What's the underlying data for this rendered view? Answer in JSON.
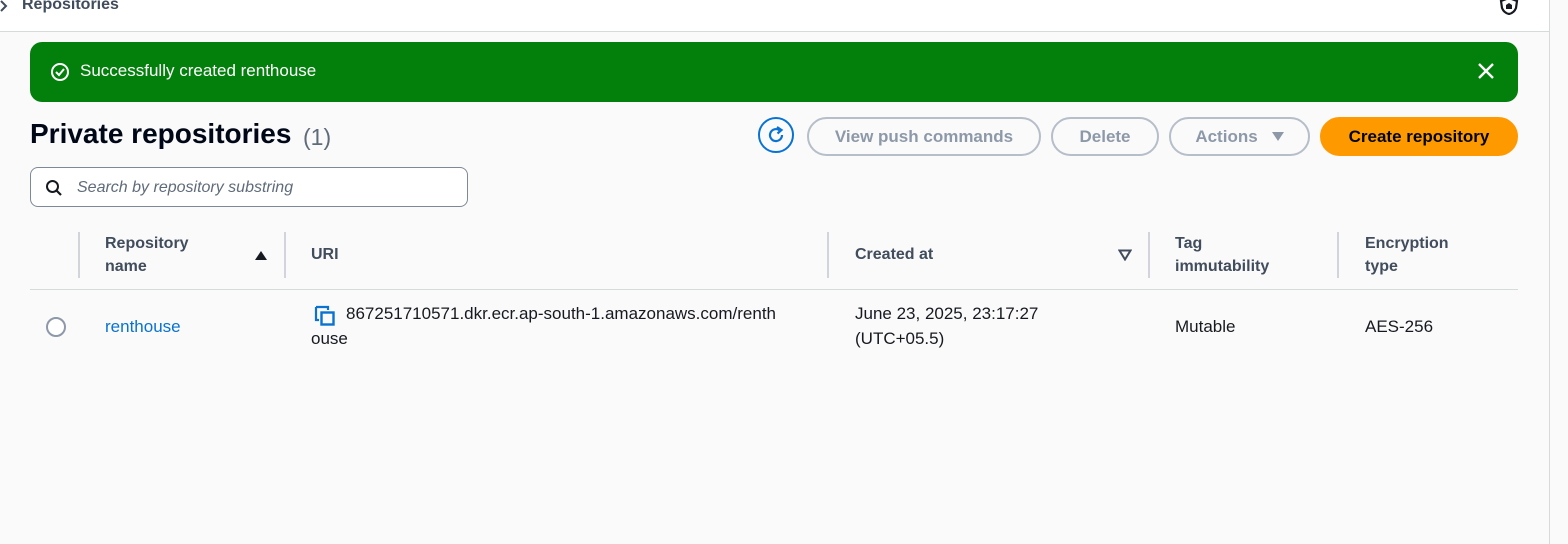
{
  "breadcrumb": {
    "current": "Repositories"
  },
  "flash": {
    "message": "Successfully created renthouse",
    "color": "#037f0c"
  },
  "page": {
    "title": "Private repositories",
    "count": "(1)"
  },
  "toolbar": {
    "view_push": "View push commands",
    "delete": "Delete",
    "actions": "Actions",
    "create": "Create repository",
    "primary_color": "#ff9900"
  },
  "search": {
    "placeholder": "Search by repository substring",
    "value": ""
  },
  "table": {
    "columns": {
      "name": [
        "Repository",
        "name"
      ],
      "uri": "URI",
      "created": "Created at",
      "tag": [
        "Tag",
        "immutability"
      ],
      "encryption": [
        "Encryption",
        "type"
      ]
    },
    "rows": [
      {
        "name": "renthouse",
        "uri_line1": "867251710571.dkr.ecr.ap-south-1.amazonaws.com/renth",
        "uri_line2": "ouse",
        "created_line1": "June 23, 2025, 23:17:27",
        "created_line2": "(UTC+05.5)",
        "tag_immutability": "Mutable",
        "encryption": "AES-256"
      }
    ]
  },
  "icons": [
    "chevron-right-icon",
    "shield-icon",
    "success-icon",
    "close-icon",
    "refresh-icon",
    "caret-down-icon",
    "search-icon",
    "sort-ascending-icon",
    "sort-descending-icon",
    "copy-icon"
  ]
}
